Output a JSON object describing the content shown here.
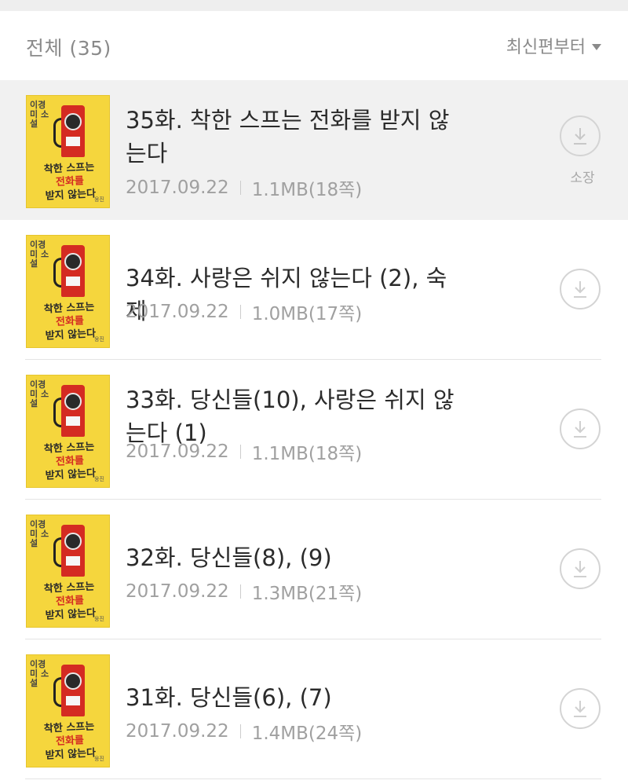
{
  "header": {
    "title": "전체 (35)",
    "sort_label": "최신편부터"
  },
  "cover": {
    "author": "이경미 소설",
    "title_line1": "착한 스프는",
    "title_line2": "전화를",
    "title_line3": "받지 않는다",
    "publisher": "웅진"
  },
  "episodes": [
    {
      "title": "35화. 착한 스프는 전화를 받지 않는다",
      "date": "2017.09.22",
      "size": "1.1MB(18쪽)",
      "status": "소장"
    },
    {
      "title": "34화. 사랑은 쉬지 않는다 (2), 숙제",
      "date": "2017.09.22",
      "size": "1.0MB(17쪽)",
      "status": ""
    },
    {
      "title": "33화. 당신들(10), 사랑은 쉬지 않는다 (1)",
      "date": "2017.09.22",
      "size": "1.1MB(18쪽)",
      "status": ""
    },
    {
      "title": "32화. 당신들(8), (9)",
      "date": "2017.09.22",
      "size": "1.3MB(21쪽)",
      "status": ""
    },
    {
      "title": "31화. 당신들(6), (7)",
      "date": "2017.09.22",
      "size": "1.4MB(24쪽)",
      "status": ""
    }
  ],
  "icons": {
    "download": "download-icon",
    "sort_caret": "caret-down-icon"
  },
  "colors": {
    "selected_row": "#f1f1f1",
    "cover_yellow": "#f5d63d",
    "cover_red": "#d42b22"
  }
}
